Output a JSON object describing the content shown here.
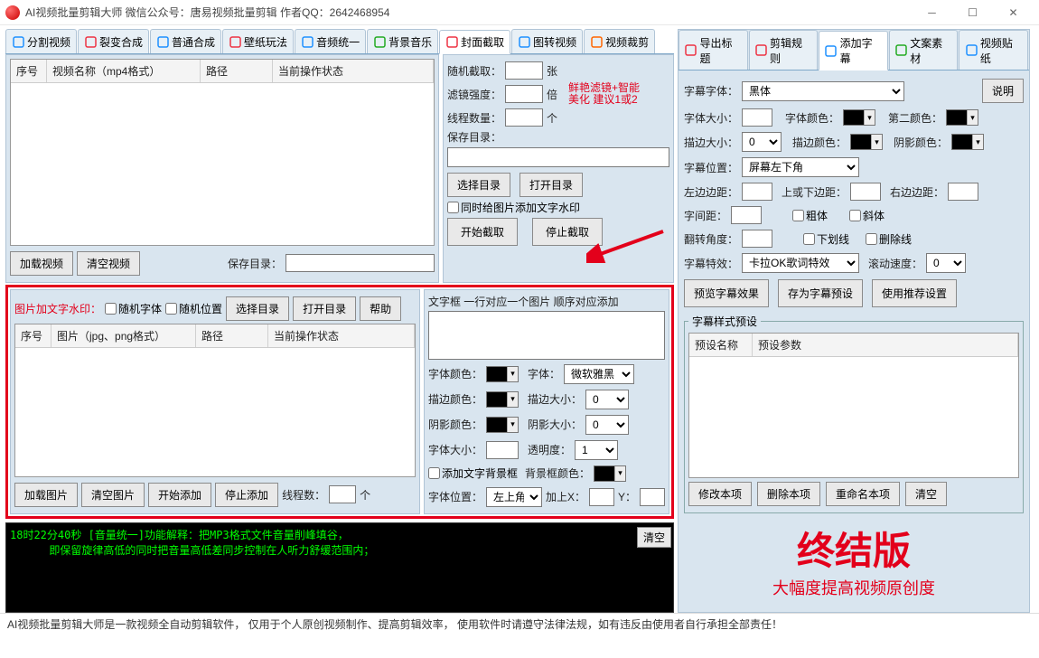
{
  "title": "AI视频批量剪辑大师   微信公众号：唐易视频批量剪辑    作者QQ：2642468954",
  "leftTabs": [
    {
      "icon": "#1e90ff",
      "label": "分割视频"
    },
    {
      "icon": "#e34",
      "label": "裂变合成"
    },
    {
      "icon": "#1e90ff",
      "label": "普通合成"
    },
    {
      "icon": "#e34",
      "label": "壁纸玩法"
    },
    {
      "icon": "#1e90ff",
      "label": "音频统一"
    },
    {
      "icon": "#2a2",
      "label": "背景音乐"
    },
    {
      "icon": "#e34",
      "label": "封面截取",
      "active": true
    },
    {
      "icon": "#1e90ff",
      "label": "图转视频"
    },
    {
      "icon": "#f60",
      "label": "视频裁剪"
    }
  ],
  "rightTabs": [
    {
      "icon": "#e34",
      "label": "导出标题"
    },
    {
      "icon": "#e34",
      "label": "剪辑规则"
    },
    {
      "icon": "#1e90ff",
      "label": "添加字幕",
      "active": true
    },
    {
      "icon": "#2a2",
      "label": "文案素材"
    },
    {
      "icon": "#1e90ff",
      "label": "视频贴纸"
    }
  ],
  "videoGrid": {
    "cols": [
      "序号",
      "视频名称（mp4格式）",
      "路径",
      "当前操作状态"
    ]
  },
  "videoBtns": {
    "load": "加载视频",
    "clear": "清空视频",
    "saveDirLbl": "保存目录："
  },
  "cover": {
    "randCap": "随机截取：",
    "pcs": "张",
    "filter": "滤镜强度：",
    "bei": "倍",
    "hint1": "鲜艳滤镜+智能",
    "hint2": "美化 建议1或2",
    "threads": "线程数量：",
    "ge": "个",
    "saveDir": "保存目录：",
    "chooseDir": "选择目录",
    "openDir": "打开目录",
    "watermark": "同时给图片添加文字水印",
    "start": "开始截取",
    "stop": "停止截取"
  },
  "imgFrame": {
    "title": "图片加文字水印：",
    "randFont": "随机字体",
    "randPos": "随机位置",
    "chooseDir": "选择目录",
    "openDir": "打开目录",
    "help": "帮助",
    "cols": [
      "序号",
      "图片（jpg、png格式）",
      "路径",
      "当前操作状态"
    ],
    "load": "加载图片",
    "clear": "清空图片",
    "start": "开始添加",
    "stop": "停止添加",
    "threads": "线程数：",
    "ge": "个"
  },
  "textFrame": {
    "title": "文字框 一行对应一个图片 顺序对应添加",
    "fontColor": "字体颜色：",
    "font": "字体：",
    "fontVal": "微软雅黑",
    "stroke": "描边颜色：",
    "strokeSize": "描边大小：",
    "strokeVal": "0",
    "shadow": "阴影颜色：",
    "shadowSize": "阴影大小：",
    "shadowVal": "0",
    "fontSize": "字体大小：",
    "opacity": "透明度：",
    "opacityVal": "1",
    "bgChk": "添加文字背景框",
    "bgColor": "背景框颜色：",
    "pos": "字体位置：",
    "posVal": "左上角",
    "addX": "加上X：",
    "Y": "Y："
  },
  "subtitle": {
    "explain": "说明",
    "font": "字幕字体：",
    "fontVal": "黑体",
    "fontSize": "字体大小：",
    "fontColor": "字体颜色：",
    "color2": "第二颜色：",
    "strokeSize": "描边大小：",
    "strokeVal": "0",
    "strokeColor": "描边颜色：",
    "shadowColor": "阴影颜色：",
    "pos": "字幕位置：",
    "posVal": "屏幕左下角",
    "leftMargin": "左边边距：",
    "topMargin": "上或下边距：",
    "rightMargin": "右边边距：",
    "spacing": "字间距：",
    "bold": "粗体",
    "italic": "斜体",
    "rotate": "翻转角度：",
    "underline": "下划线",
    "strike": "删除线",
    "effect": "字幕特效：",
    "effectVal": "卡拉OK歌词特效",
    "scroll": "滚动速度：",
    "scrollVal": "0",
    "preview": "预览字幕效果",
    "savePreset": "存为字幕预设",
    "recommend": "使用推荐设置",
    "presetLegend": "字幕样式预设",
    "presetCols": [
      "预设名称",
      "预设参数"
    ],
    "modify": "修改本项",
    "delete": "删除本项",
    "rename": "重命名本项",
    "clear": "清空"
  },
  "log": "18时22分40秒 [音量统一]功能解释：把MP3格式文件音量削峰填谷，\n      即保留旋律高低的同时把音量高低差同步控制在人听力舒缓范围内；",
  "logClear": "清空",
  "brand": {
    "big": "终结版",
    "sub": "大幅度提高视频原创度"
  },
  "footer": "AI视频批量剪辑大师是一款视频全自动剪辑软件，  仅用于个人原创视频制作、提高剪辑效率，  使用软件时请遵守法律法规，如有违反由使用者自行承担全部责任！"
}
